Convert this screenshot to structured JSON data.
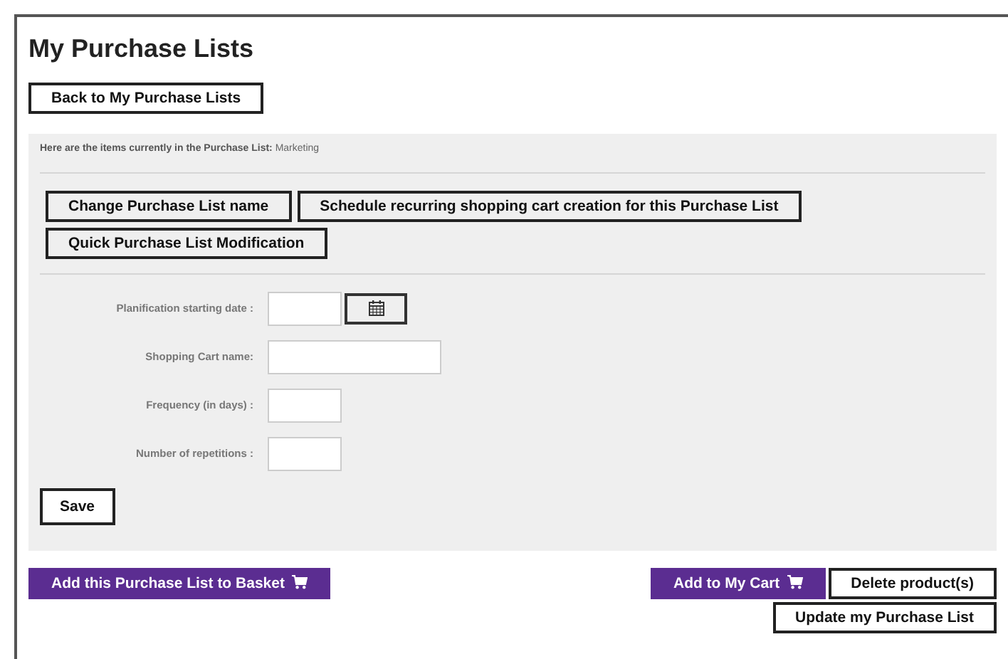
{
  "title": "My Purchase Lists",
  "back_button": "Back to My Purchase Lists",
  "panel": {
    "intro": {
      "label": "Here are the items currently in the Purchase List:",
      "value": "Marketing"
    },
    "actions": [
      "Change Purchase List name",
      "Schedule recurring shopping cart creation for this Purchase List",
      "Quick Purchase List Modification"
    ],
    "fields": [
      {
        "label": "Planification starting date :",
        "kind": "date"
      },
      {
        "label": "Shopping Cart name:",
        "kind": "wide"
      },
      {
        "label": "Frequency (in days) :",
        "kind": "short"
      },
      {
        "label": "Number of repetitions :",
        "kind": "short"
      }
    ],
    "save": "Save"
  },
  "footer_left": [
    {
      "label": "Add this Purchase List to Basket",
      "kind": "primary",
      "cart_icon": true
    }
  ],
  "footer_right": [
    {
      "label": "Add to My Cart",
      "kind": "primary",
      "cart_icon": true
    },
    {
      "label": "Delete product(s)",
      "kind": "outline",
      "cart_icon": false
    },
    {
      "label": "Update my Purchase List",
      "kind": "outline",
      "cart_icon": false
    }
  ]
}
